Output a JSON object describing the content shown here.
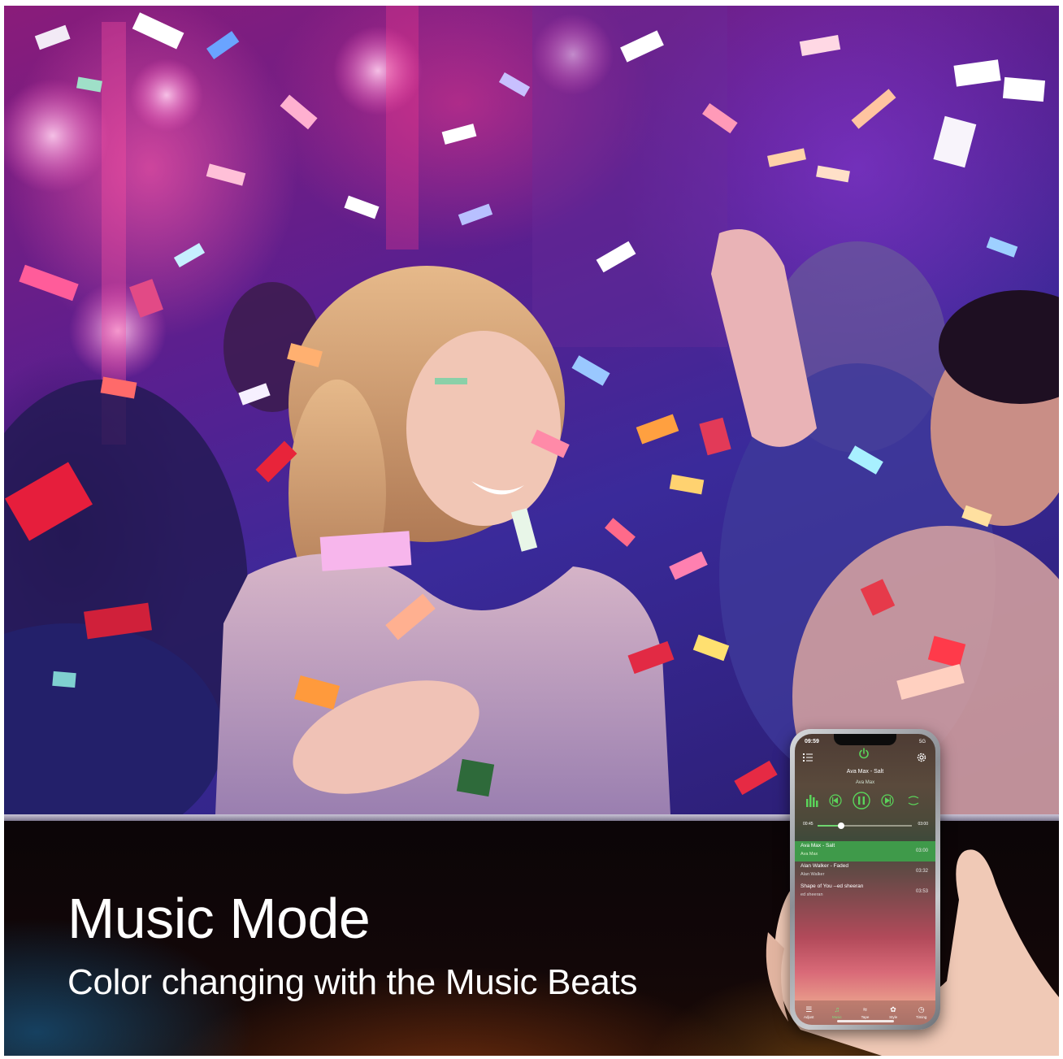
{
  "banner": {
    "title": "Music Mode",
    "subtitle": "Color changing with the Music Beats"
  },
  "phone": {
    "status": {
      "time": "09:59",
      "signal": "5G"
    },
    "now_playing": {
      "title": "Ava Max - Salt",
      "artist": "Ava Max"
    },
    "progress": {
      "elapsed": "00:45",
      "total": "03:00",
      "fraction": 0.25
    },
    "playlist": [
      {
        "name": "Ava Max - Salt",
        "artist": "Ava Max",
        "duration": "03:00",
        "active": true
      },
      {
        "name": "Alan Walker - Faded",
        "artist": "Alan Walker",
        "duration": "03:32",
        "active": false
      },
      {
        "name": "Shape of You --ed sheeran",
        "artist": "ed sheeran",
        "duration": "03:53",
        "active": false
      }
    ],
    "tabs": [
      {
        "label": "Adjust",
        "icon": "sliders-icon"
      },
      {
        "label": "Music",
        "icon": "music-note-icon"
      },
      {
        "label": "Tape",
        "icon": "waves-icon"
      },
      {
        "label": "Style",
        "icon": "style-icon"
      },
      {
        "label": "Timing",
        "icon": "clock-icon"
      }
    ],
    "accent_color": "#3f9a4a"
  },
  "colors": {
    "banner_text": "#ffffff",
    "photo_tint": "#8a1c7a"
  }
}
